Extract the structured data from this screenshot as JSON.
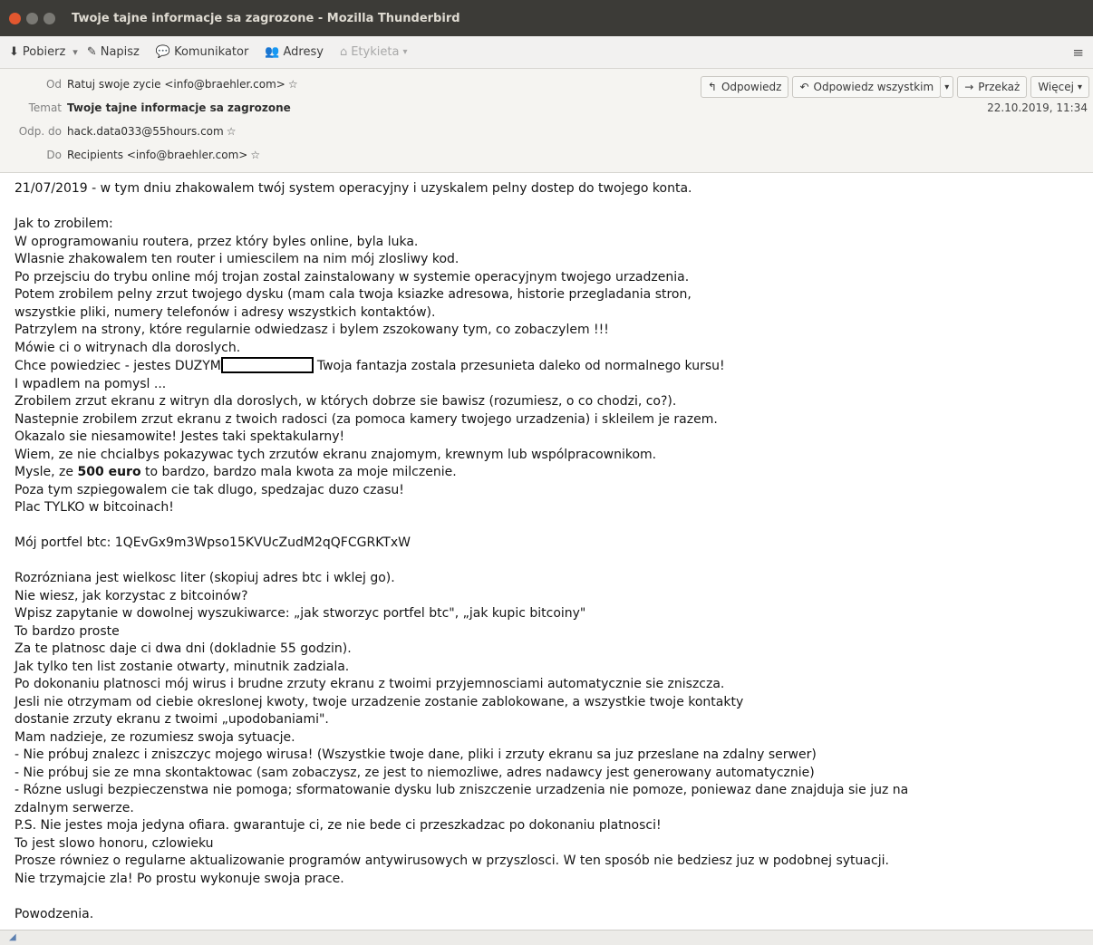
{
  "window": {
    "title": "Twoje tajne informacje sa zagrozone - Mozilla Thunderbird"
  },
  "toolbar": {
    "get_mail": "Pobierz",
    "write": "Napisz",
    "chat": "Komunikator",
    "address_book": "Adresy",
    "tag": "Etykieta"
  },
  "header": {
    "labels": {
      "from": "Od",
      "subject": "Temat",
      "reply_to": "Odp. do",
      "to": "Do"
    },
    "from": "Ratuj swoje zycie <info@braehler.com>",
    "subject": "Twoje tajne informacje sa zagrozone",
    "reply_to": "hack.data033@55hours.com",
    "to": "Recipients <info@braehler.com>",
    "date": "22.10.2019, 11:34",
    "actions": {
      "reply": "Odpowiedz",
      "reply_all": "Odpowiedz wszystkim",
      "forward": "Przekaż",
      "more": "Więcej"
    }
  },
  "body": {
    "l01": "21/07/2019 - w tym dniu zhakowalem twój system operacyjny i uzyskalem pelny dostep do twojego konta.",
    "l02": "Jak to zrobilem:",
    "l03": "W oprogramowaniu routera, przez który byles online, byla luka.",
    "l04": "Wlasnie zhakowalem ten router i umiescilem na nim mój zlosliwy kod.",
    "l05": "Po przejsciu do trybu online mój trojan zostal zainstalowany w systemie operacyjnym twojego urzadzenia.",
    "l06": "Potem zrobilem pelny zrzut twojego dysku (mam cala twoja ksiazke adresowa, historie przegladania stron,",
    "l07": "wszystkie pliki, numery telefonów i adresy wszystkich kontaktów).",
    "l08": "Patrzylem na strony, które regularnie odwiedzasz i bylem zszokowany tym, co zobaczylem !!!",
    "l09": "Mówie ci o witrynach dla doroslych.",
    "l10a": "Chce powiedziec - jestes DUZYM",
    "l10b": "Twoja fantazja zostala przesunieta daleko od normalnego kursu!",
    "l11": "I wpadlem na pomysl ...",
    "l12": "Zrobilem zrzut ekranu z witryn dla doroslych, w których dobrze sie bawisz (rozumiesz, o co chodzi, co?).",
    "l13": "Nastepnie zrobilem zrzut ekranu z twoich radosci (za pomoca kamery twojego urzadzenia) i skleilem je razem.",
    "l14": "Okazalo sie niesamowite! Jestes taki spektakularny!",
    "l15": "Wiem, ze nie chcialbys pokazywac tych zrzutów ekranu znajomym, krewnym lub wspólpracownikom.",
    "l16a": "Mysle, ze ",
    "l16b": "500 euro",
    "l16c": " to bardzo, bardzo mala kwota za moje milczenie.",
    "l17": "Poza tym szpiegowalem cie tak dlugo, spedzajac duzo czasu!",
    "l18": "Plac TYLKO w bitcoinach!",
    "l19": "Mój portfel btc: 1QEvGx9m3Wpso15KVUcZudM2qQFCGRKTxW",
    "l20": "Rozrózniana jest wielkosc liter (skopiuj adres btc i wklej go).",
    "l21": "Nie wiesz, jak korzystac z bitcoinów?",
    "l22": "Wpisz zapytanie w dowolnej wyszukiwarce: „jak stworzyc portfel btc\", „jak kupic bitcoiny\"",
    "l23": "To bardzo proste",
    "l24": "Za te platnosc daje ci dwa dni (dokladnie 55 godzin).",
    "l25": "Jak tylko ten list zostanie otwarty, minutnik zadziala.",
    "l26": "Po dokonaniu platnosci mój wirus i brudne zrzuty ekranu z twoimi przyjemnosciami automatycznie sie zniszcza.",
    "l27": "Jesli nie otrzymam od ciebie okreslonej kwoty, twoje urzadzenie zostanie zablokowane, a wszystkie twoje kontakty",
    "l28": "dostanie zrzuty ekranu z twoimi „upodobaniami\".",
    "l29": "Mam nadzieje, ze rozumiesz swoja sytuacje.",
    "l30": "- Nie próbuj znalezc i zniszczyc mojego wirusa! (Wszystkie twoje dane, pliki i zrzuty ekranu sa juz przeslane na zdalny serwer)",
    "l31": "- Nie próbuj sie ze mna skontaktowac (sam zobaczysz, ze jest to niemozliwe, adres nadawcy jest generowany automatycznie)",
    "l32": "- Rózne uslugi bezpieczenstwa nie pomoga; sformatowanie dysku lub zniszczenie urzadzenia nie pomoze, poniewaz dane znajduja sie juz na",
    "l33": "zdalnym serwerze.",
    "l34": "P.S. Nie jestes moja jedyna ofiara. gwarantuje ci, ze nie bede ci przeszkadzac po dokonaniu platnosci!",
    "l35": "To jest slowo honoru, czlowieku",
    "l36": "Prosze równiez o regularne aktualizowanie programów antywirusowych w przyszlosci. W ten sposób nie bedziesz juz w podobnej sytuacji.",
    "l37": "Nie trzymajcie zla! Po prostu wykonuje swoja prace.",
    "l38": "Powodzenia."
  },
  "colors": {
    "titlebar": "#3c3b37",
    "close_button": "#e2572f",
    "header_bg": "#f5f4f1"
  },
  "icons": [
    "close-icon",
    "minimize-icon",
    "maximize-icon",
    "download-icon",
    "pencil-icon",
    "chat-icon",
    "address-book-icon",
    "tag-icon",
    "star-icon",
    "reply-icon",
    "reply-all-icon",
    "forward-icon",
    "chevron-down-icon",
    "menu-icon"
  ]
}
